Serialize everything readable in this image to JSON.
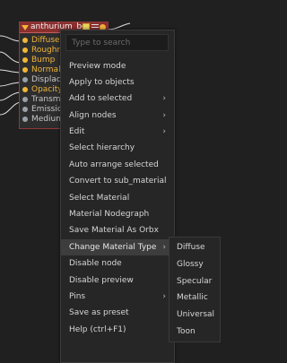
{
  "node": {
    "title": "anthurium_bo",
    "icons": [
      "collapse-icon",
      "color-swatch-icon",
      "list-icon",
      "output-dot-icon"
    ],
    "pins": [
      {
        "label": "Diffuse",
        "active": true
      },
      {
        "label": "Roughne",
        "active": true
      },
      {
        "label": "Bump",
        "active": true
      },
      {
        "label": "Normal",
        "active": true
      },
      {
        "label": "Displace",
        "active": false
      },
      {
        "label": "Opacity",
        "active": true
      },
      {
        "label": "Transmis",
        "active": false
      },
      {
        "label": "Emission",
        "active": false
      },
      {
        "label": "Medium",
        "active": false
      }
    ]
  },
  "menu": {
    "search_placeholder": "Type to search",
    "items": [
      {
        "label": "Preview mode",
        "submenu": false
      },
      {
        "label": "Apply to objects",
        "submenu": false
      },
      {
        "label": "Add to selected",
        "submenu": true
      },
      {
        "label": "Align nodes",
        "submenu": true
      },
      {
        "label": "Edit",
        "submenu": true
      },
      {
        "label": "Select hierarchy",
        "submenu": false
      },
      {
        "label": "Auto arrange selected",
        "submenu": false
      },
      {
        "label": "Convert to sub_material",
        "submenu": false
      },
      {
        "label": "Select Material",
        "submenu": false
      },
      {
        "label": "Material Nodegraph",
        "submenu": false
      },
      {
        "label": "Save Material As Orbx",
        "submenu": false
      },
      {
        "label": "Change Material Type",
        "submenu": true,
        "highlighted": true
      },
      {
        "label": "Disable node",
        "submenu": false
      },
      {
        "label": "Disable preview",
        "submenu": false
      },
      {
        "label": "Pins",
        "submenu": true
      },
      {
        "label": "Save as preset",
        "submenu": false
      },
      {
        "label": "Help (ctrl+F1)",
        "submenu": false
      }
    ],
    "submenu_arrow": "›"
  },
  "submenu": {
    "items": [
      "Diffuse",
      "Glossy",
      "Specular",
      "Metallic",
      "Universal",
      "Toon"
    ]
  },
  "colors": {
    "background": "#202020",
    "node_header": "#8b2f2f",
    "active_pin": "#f0b53a",
    "inactive_pin": "#9aa0a6",
    "menu_bg": "#262626",
    "highlight": "#3d3d3d"
  }
}
